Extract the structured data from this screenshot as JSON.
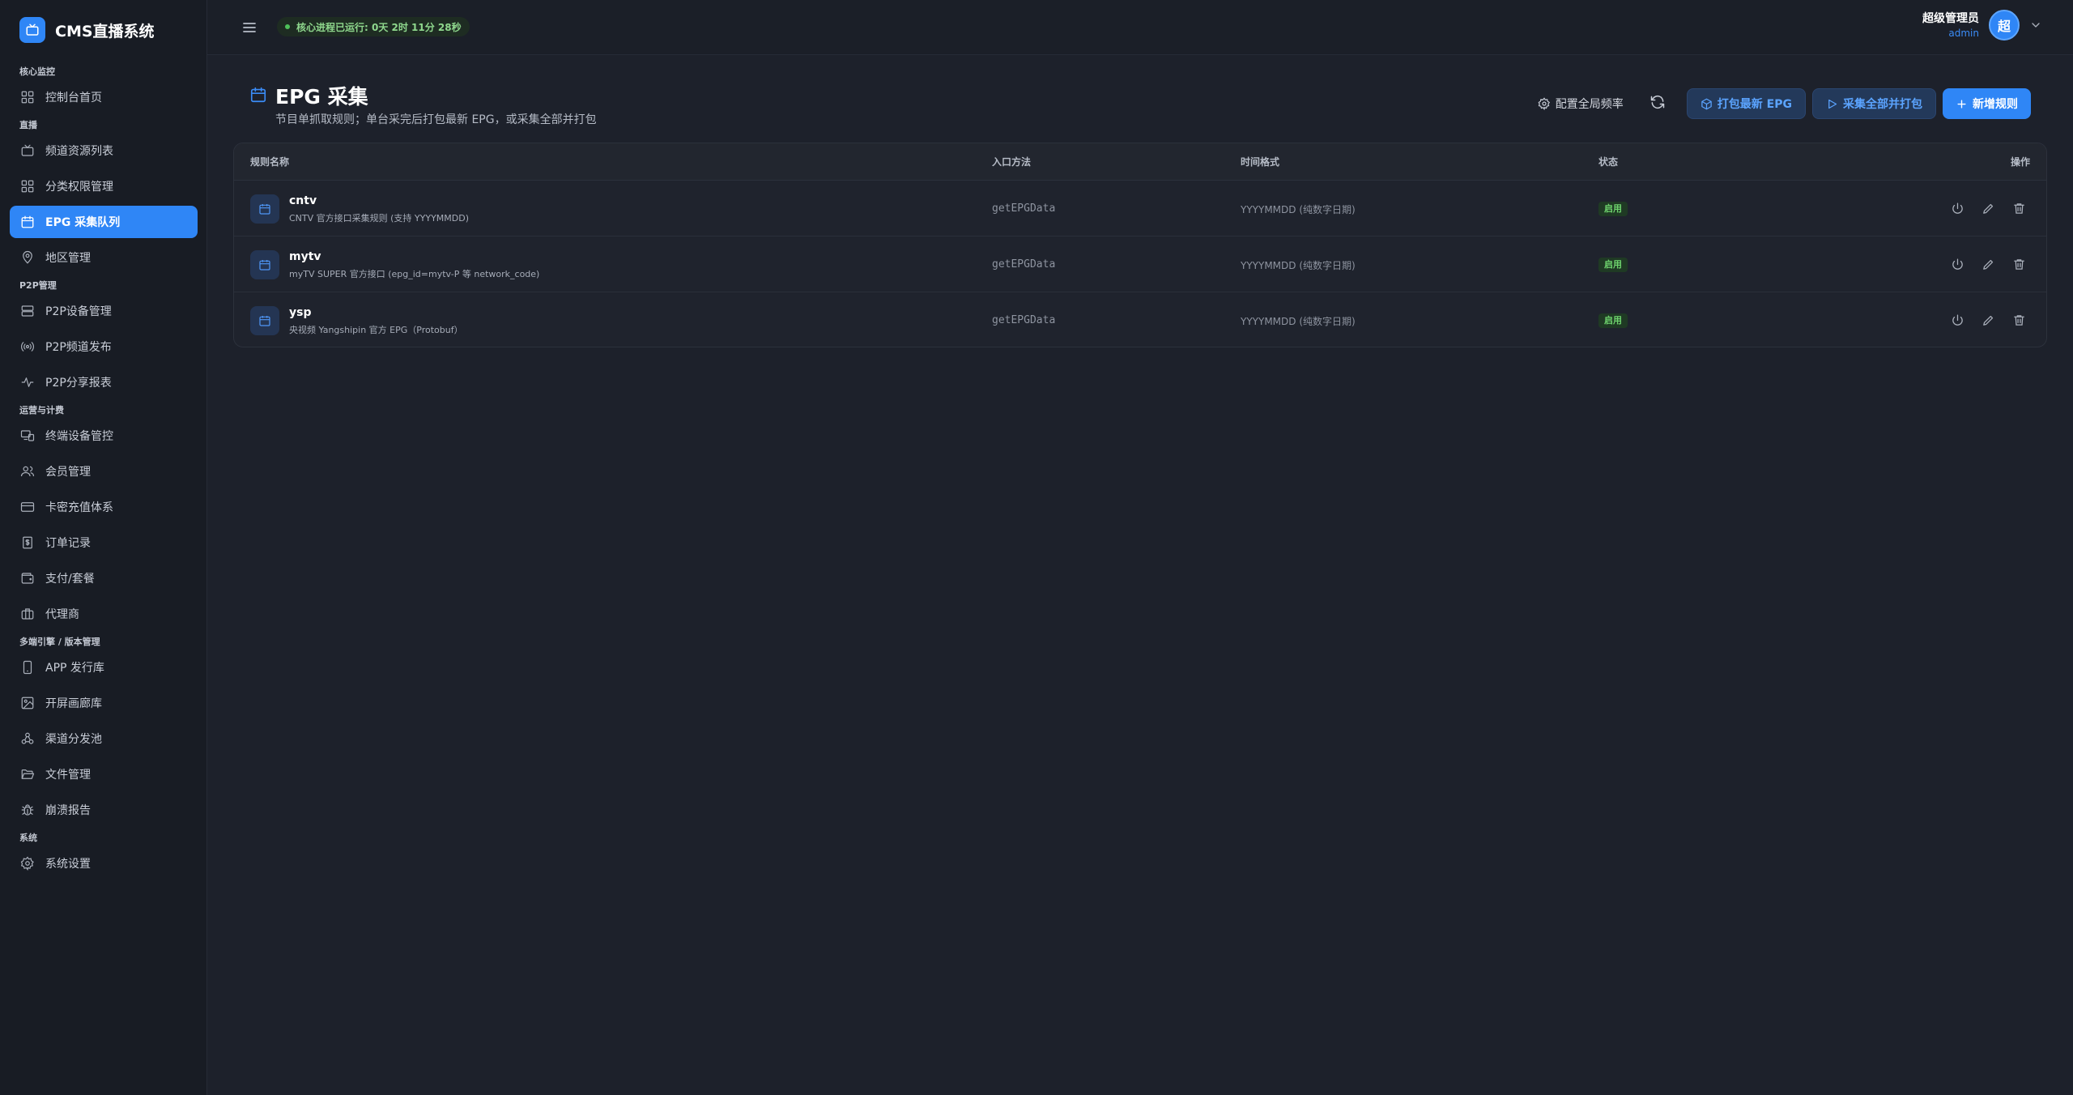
{
  "app": {
    "title": "CMS直播系统"
  },
  "sidebar": {
    "sections": [
      {
        "title": "核心监控",
        "items": [
          {
            "label": "控制台首页",
            "icon": "dashboard-icon"
          }
        ]
      },
      {
        "title": "直播",
        "items": [
          {
            "label": "频道资源列表",
            "icon": "tv-icon"
          },
          {
            "label": "分类权限管理",
            "icon": "grid-icon"
          },
          {
            "label": "EPG 采集队列",
            "icon": "calendar-icon",
            "active": true
          },
          {
            "label": "地区管理",
            "icon": "map-pin-icon"
          }
        ]
      },
      {
        "title": "P2P管理",
        "items": [
          {
            "label": "P2P设备管理",
            "icon": "server-icon"
          },
          {
            "label": "P2P频道发布",
            "icon": "broadcast-icon"
          },
          {
            "label": "P2P分享报表",
            "icon": "activity-icon"
          }
        ]
      },
      {
        "title": "运营与计费",
        "items": [
          {
            "label": "终端设备管控",
            "icon": "devices-icon"
          },
          {
            "label": "会员管理",
            "icon": "users-icon"
          },
          {
            "label": "卡密充值体系",
            "icon": "card-icon"
          },
          {
            "label": "订单记录",
            "icon": "receipt-icon"
          },
          {
            "label": "支付/套餐",
            "icon": "wallet-icon"
          },
          {
            "label": "代理商",
            "icon": "briefcase-icon"
          }
        ]
      },
      {
        "title": "多端引擎 / 版本管理",
        "items": [
          {
            "label": "APP 发行库",
            "icon": "phone-icon"
          },
          {
            "label": "开屏画廊库",
            "icon": "image-icon"
          },
          {
            "label": "渠道分发池",
            "icon": "network-icon"
          },
          {
            "label": "文件管理",
            "icon": "folder-icon"
          },
          {
            "label": "崩溃报告",
            "icon": "bug-icon"
          }
        ]
      },
      {
        "title": "系统",
        "items": [
          {
            "label": "系统设置",
            "icon": "gear-icon"
          }
        ]
      }
    ]
  },
  "header": {
    "uptime": "核心进程已运行: 0天 2时 11分 28秒",
    "user_name": "超级管理员",
    "user_role": "admin",
    "avatar_text": "超"
  },
  "page": {
    "title": "EPG 采集",
    "subtitle": "节目单抓取规则；单台采完后打包最新 EPG，或采集全部并打包",
    "actions": {
      "config_label": "配置全局频率",
      "pack_label": "打包最新 EPG",
      "collect_all_label": "采集全部并打包",
      "add_label": "新增规则"
    }
  },
  "table": {
    "headers": {
      "name": "规则名称",
      "method": "入口方法",
      "format": "时间格式",
      "status": "状态",
      "ops": "操作"
    },
    "rows": [
      {
        "name": "cntv",
        "desc": "CNTV 官方接口采集规则 (支持 YYYYMMDD)",
        "method": "getEPGData",
        "format": "YYYYMMDD (纯数字日期)",
        "status": "启用"
      },
      {
        "name": "mytv",
        "desc": "myTV SUPER 官方接口 (epg_id=mytv-P 等 network_code)",
        "method": "getEPGData",
        "format": "YYYYMMDD (纯数字日期)",
        "status": "启用"
      },
      {
        "name": "ysp",
        "desc": "央视频 Yangshipin 官方 EPG（Protobuf）",
        "method": "getEPGData",
        "format": "YYYYMMDD (纯数字日期)",
        "status": "启用"
      }
    ]
  },
  "colors": {
    "accent": "#2f86f6",
    "success": "#6ed36d",
    "bg": "#1d212b",
    "sidebar": "#181c24"
  }
}
